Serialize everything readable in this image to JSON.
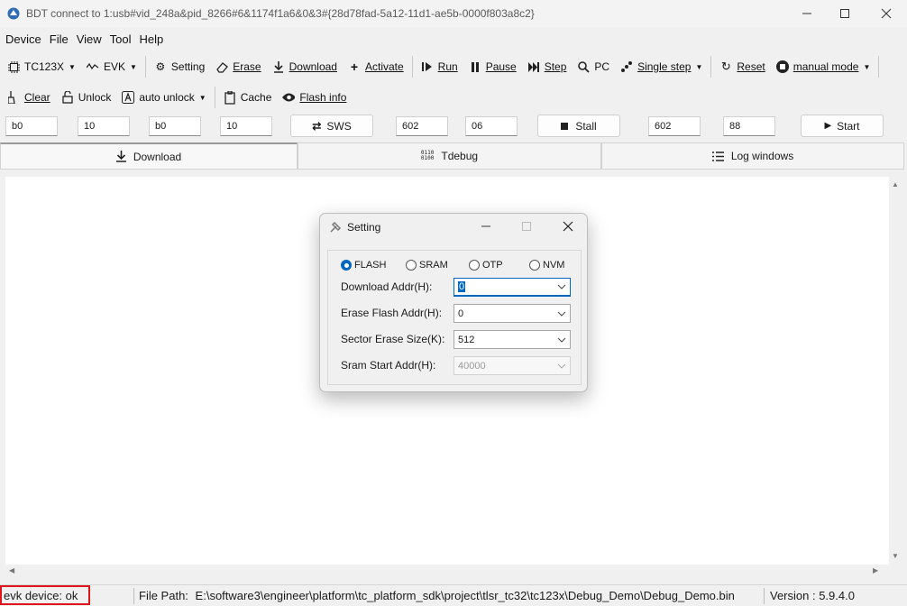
{
  "window": {
    "title": "BDT connect to 1:usb#vid_248a&pid_8266#6&1174f1a6&0&3#{28d78fad-5a12-11d1-ae5b-0000f803a8c2}"
  },
  "menu": [
    "Device",
    "File",
    "View",
    "Tool",
    "Help"
  ],
  "toolbar1": {
    "chip": "TC123X",
    "board": "EVK",
    "setting": "Setting",
    "erase": "Erase",
    "download": "Download",
    "activate": "Activate",
    "run": "Run",
    "pause": "Pause",
    "step": "Step",
    "pc": "PC",
    "single_step": "Single step",
    "reset": "Reset",
    "manual_mode": "manual mode"
  },
  "toolbar2": {
    "clear": "Clear",
    "unlock": "Unlock",
    "auto_unlock": "auto unlock",
    "cache": "Cache",
    "flash_info": "Flash info"
  },
  "inputs": {
    "f1": "b0",
    "f2": "10",
    "f3": "b0",
    "f4": "10",
    "sws_label": "SWS",
    "f5": "602",
    "f6": "06",
    "stall_label": "Stall",
    "f7": "602",
    "f8": "88",
    "start_label": "Start"
  },
  "tabs": [
    "Download",
    "Tdebug",
    "Log windows"
  ],
  "dialog": {
    "title": "Setting",
    "radios": [
      "FLASH",
      "SRAM",
      "OTP",
      "NVM"
    ],
    "selected": "FLASH",
    "download_addr_label": "Download  Addr(H):",
    "download_addr_value": "0",
    "erase_addr_label": "Erase Flash Addr(H):",
    "erase_addr_value": "0",
    "sector_size_label": "Sector Erase Size(K):",
    "sector_size_value": "512",
    "sram_start_label": "Sram Start Addr(H):",
    "sram_start_value": "40000"
  },
  "status": {
    "device": "evk device: ok",
    "file_path_label": "File Path:",
    "file_path": "E:\\software3\\engineer\\platform\\tc_platform_sdk\\project\\tlsr_tc32\\tc123x\\Debug_Demo\\Debug_Demo.bin",
    "version": "Version : 5.9.4.0"
  },
  "colors": {
    "accent": "#0067c0",
    "status_border": "#e0151b"
  }
}
